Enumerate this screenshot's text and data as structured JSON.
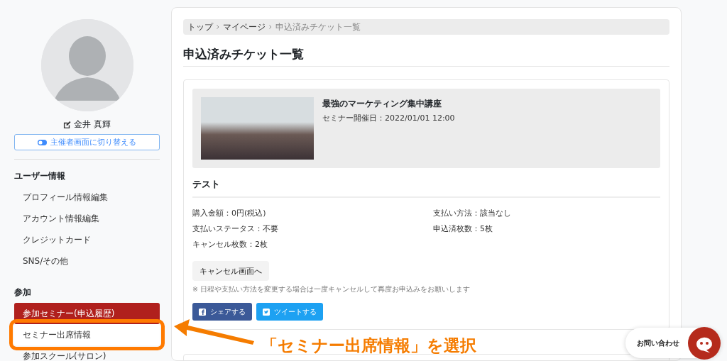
{
  "sidebar": {
    "user_name": "金井 真輝",
    "switch_button": "主催者画面に切り替える",
    "sections": [
      {
        "heading": "ユーザー情報",
        "items": [
          {
            "label": "プロフィール情報編集",
            "selected": false,
            "highlighted": false
          },
          {
            "label": "アカウント情報編集",
            "selected": false,
            "highlighted": false
          },
          {
            "label": "クレジットカード",
            "selected": false,
            "highlighted": false
          },
          {
            "label": "SNS/その他",
            "selected": false,
            "highlighted": false
          }
        ]
      },
      {
        "heading": "参加",
        "items": [
          {
            "label": "参加セミナー(申込履歴)",
            "selected": true,
            "highlighted": false
          },
          {
            "label": "セミナー出席情報",
            "selected": false,
            "highlighted": true
          },
          {
            "label": "参加スクール(サロン)",
            "selected": false,
            "highlighted": false
          }
        ]
      }
    ]
  },
  "breadcrumb": [
    {
      "label": "トップ",
      "current": false
    },
    {
      "label": "マイページ",
      "current": false
    },
    {
      "label": "申込済みチケット一覧",
      "current": true
    }
  ],
  "page_title": "申込済みチケット一覧",
  "ticket": {
    "event_title": "最強のマーケティング集中講座",
    "event_date": "セミナー開催日：2022/01/01 12:00",
    "ticket_name": "テスト",
    "details": [
      "購入金額：0円(税込)",
      "支払い方法：該当なし",
      "支払いステータス：不要",
      "申込済枚数：5枚",
      "キャンセル枚数：2枚"
    ],
    "cancel_button": "キャンセル画面へ",
    "note": "※ 日程や支払い方法を変更する場合は一度キャンセルして再度お申込みをお願いします",
    "share_buttons": [
      {
        "kind": "facebook",
        "label": "シェアする"
      },
      {
        "kind": "twitter",
        "label": "ツイートする"
      }
    ]
  },
  "chat_widget": {
    "label": "お問い合わせ"
  },
  "annotation": {
    "text": "「セミナー出席情報」を選択"
  }
}
